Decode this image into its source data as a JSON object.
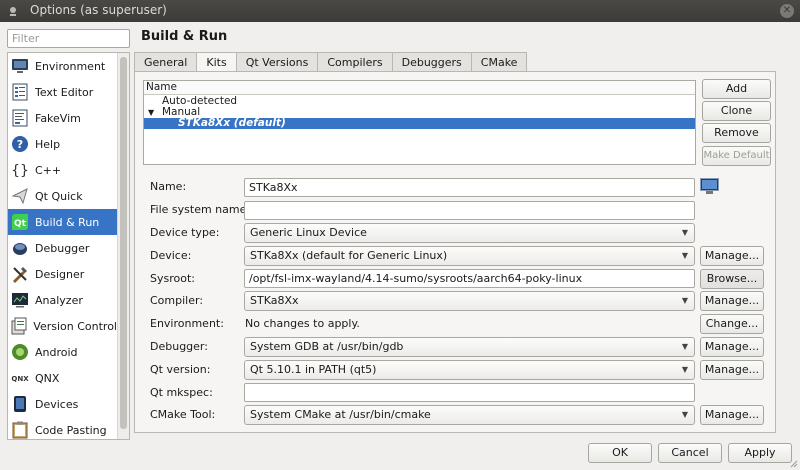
{
  "window": {
    "title": "Options (as superuser)"
  },
  "filter": {
    "placeholder": "Filter",
    "value": ""
  },
  "categories": [
    {
      "label": "Environment",
      "icon": "monitor-icon"
    },
    {
      "label": "Text Editor",
      "icon": "text-editor-icon"
    },
    {
      "label": "FakeVim",
      "icon": "fakevim-icon"
    },
    {
      "label": "Help",
      "icon": "help-icon"
    },
    {
      "label": "C++",
      "icon": "braces-icon"
    },
    {
      "label": "Qt Quick",
      "icon": "qt-quick-icon"
    },
    {
      "label": "Build & Run",
      "icon": "qt-build-run-icon",
      "selected": true
    },
    {
      "label": "Debugger",
      "icon": "debugger-icon"
    },
    {
      "label": "Designer",
      "icon": "designer-icon"
    },
    {
      "label": "Analyzer",
      "icon": "analyzer-icon"
    },
    {
      "label": "Version Control",
      "icon": "version-control-icon"
    },
    {
      "label": "Android",
      "icon": "android-icon"
    },
    {
      "label": "QNX",
      "icon": "qnx-icon"
    },
    {
      "label": "Devices",
      "icon": "devices-icon"
    },
    {
      "label": "Code Pasting",
      "icon": "clipboard-icon"
    }
  ],
  "page": {
    "title": "Build & Run"
  },
  "tabs": [
    {
      "label": "General"
    },
    {
      "label": "Kits",
      "active": true
    },
    {
      "label": "Qt Versions"
    },
    {
      "label": "Compilers"
    },
    {
      "label": "Debuggers"
    },
    {
      "label": "CMake"
    }
  ],
  "kits_tree": {
    "header": "Name",
    "rows": [
      {
        "label": "Auto-detected",
        "level": 1
      },
      {
        "label": "Manual",
        "level": 1,
        "expanded": true
      },
      {
        "label": "STKa8Xx (default)",
        "level": 2,
        "selected": true
      }
    ]
  },
  "kit_buttons": {
    "add": "Add",
    "clone": "Clone",
    "remove": "Remove",
    "make_default": "Make Default"
  },
  "form": {
    "name": {
      "label": "Name:",
      "value": "STKa8Xx"
    },
    "file_system_name": {
      "label": "File system name:",
      "value": ""
    },
    "device_type": {
      "label": "Device type:",
      "value": "Generic Linux Device"
    },
    "device": {
      "label": "Device:",
      "value": "STKa8Xx (default for Generic Linux)",
      "button": "Manage..."
    },
    "sysroot": {
      "label": "Sysroot:",
      "value": "/opt/fsl-imx-wayland/4.14-sumo/sysroots/aarch64-poky-linux",
      "button": "Browse..."
    },
    "compiler": {
      "label": "Compiler:",
      "value": "STKa8Xx",
      "button": "Manage..."
    },
    "environment": {
      "label": "Environment:",
      "value": "No changes to apply.",
      "button": "Change..."
    },
    "debugger": {
      "label": "Debugger:",
      "value": "System GDB at /usr/bin/gdb",
      "button": "Manage..."
    },
    "qt_version": {
      "label": "Qt version:",
      "value": "Qt 5.10.1 in PATH (qt5)",
      "button": "Manage..."
    },
    "qt_mkspec": {
      "label": "Qt mkspec:",
      "value": ""
    },
    "cmake_tool": {
      "label": "CMake Tool:",
      "value": "System CMake at /usr/bin/cmake",
      "button": "Manage..."
    }
  },
  "dialog_buttons": {
    "ok": "OK",
    "cancel": "Cancel",
    "apply": "Apply"
  },
  "colors": {
    "selection": "#3874c6",
    "titlebar": "#3c3b37",
    "window_bg": "#f0efee"
  }
}
